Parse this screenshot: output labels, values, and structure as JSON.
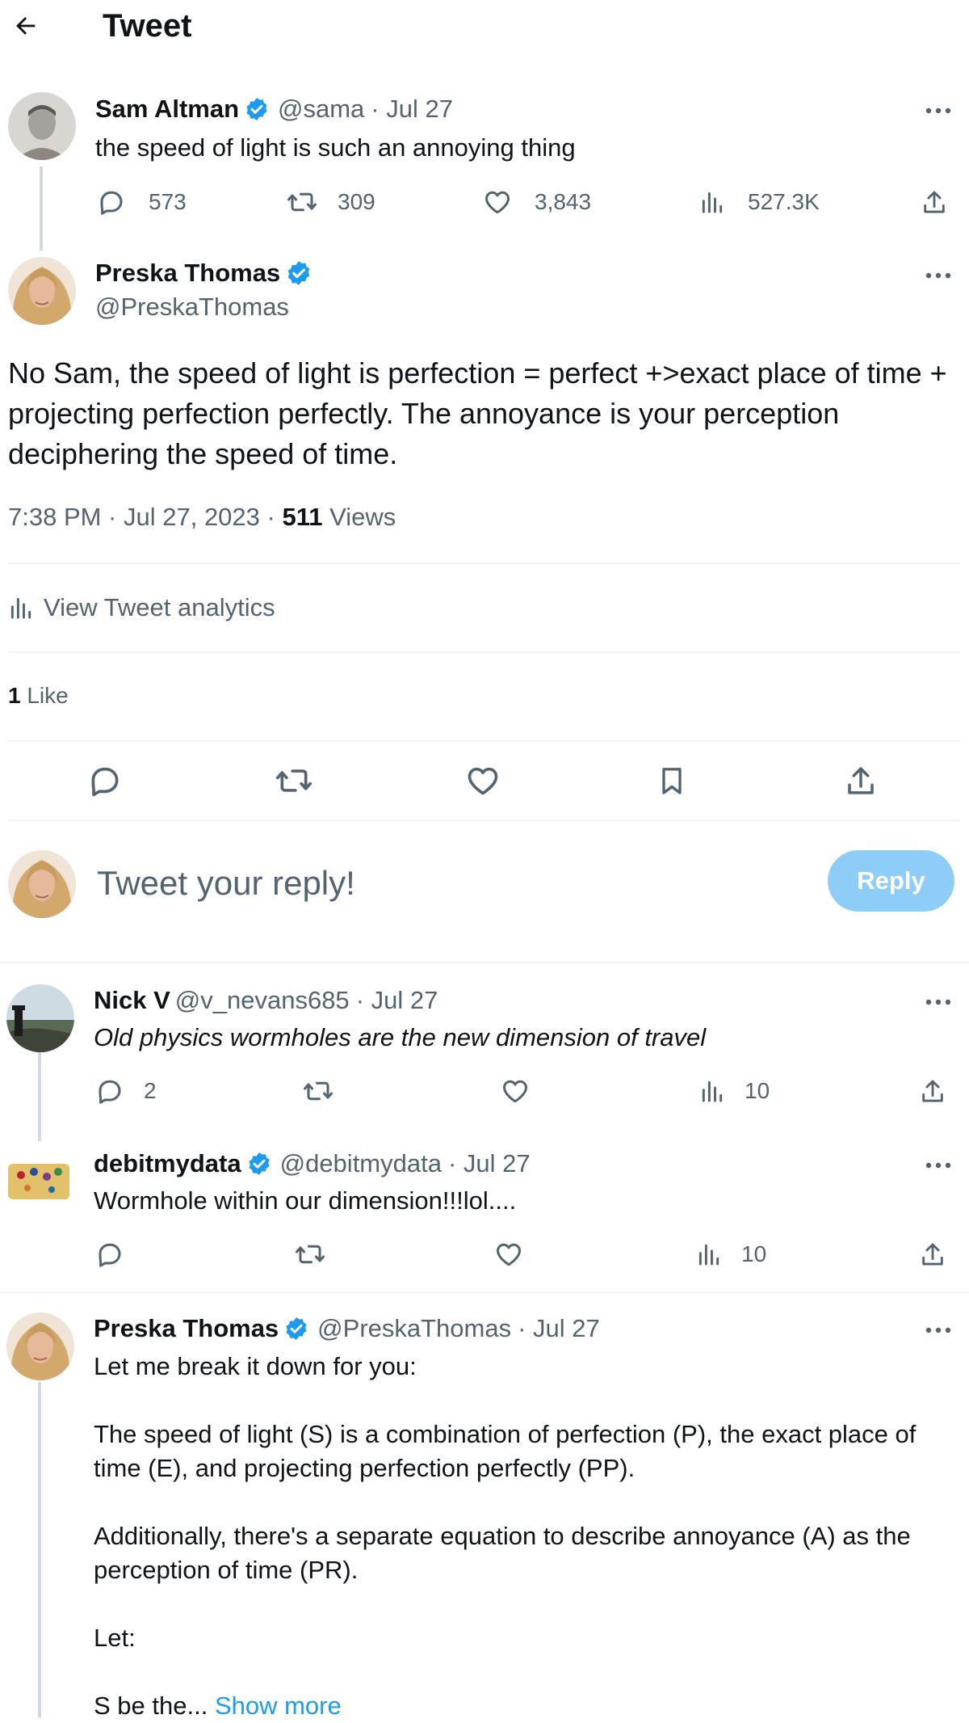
{
  "header": {
    "title": "Tweet"
  },
  "parent_tweet": {
    "author_name": "Sam Altman",
    "handle": "@sama",
    "date": "· Jul 27",
    "text": "the speed of light is such an annoying thing",
    "replies": "573",
    "retweets": "309",
    "likes": "3,843",
    "views": "527.3K"
  },
  "focal_tweet": {
    "author_name": "Preska Thomas",
    "handle": "@PreskaThomas",
    "text": "No Sam, the speed of light is perfection = perfect +>exact place of time + projecting perfection perfectly. The annoyance is your perception deciphering the speed of time.",
    "time_date": "7:38 PM · Jul 27, 2023 · ",
    "views_count": "511",
    "views_label": " Views",
    "analytics_label": "View Tweet analytics",
    "likes_count": "1",
    "likes_label": " Like"
  },
  "composer": {
    "placeholder": "Tweet your reply!",
    "reply_button": "Reply"
  },
  "replies": [
    {
      "author_name": "Nick V",
      "handle": "@v_nevans685",
      "date": "· Jul 27",
      "text": "Old physics wormholes are the new dimension of travel",
      "replies": "2",
      "retweets": "",
      "likes": "",
      "views": "10"
    },
    {
      "author_name": "debitmydata",
      "handle": "@debitmydata",
      "date": "· Jul 27",
      "text": "Wormhole within our dimension!!!lol....",
      "replies": "",
      "retweets": "",
      "likes": "",
      "views": "10"
    },
    {
      "author_name": "Preska Thomas",
      "handle": "@PreskaThomas",
      "date": "· Jul 27",
      "text": "Let me break it down for you:\n\nThe speed of light (S) is a combination of perfection (P), the exact place of time (E), and projecting perfection perfectly (PP).\n\nAdditionally, there's a separate equation to describe annoyance (A) as the perception of time (PR).\n\nLet:\n\nS be the... ",
      "show_more": "Show more"
    }
  ],
  "colors": {
    "accent": "#1d9bf0",
    "text": "#0f1419",
    "muted": "#536471",
    "divider": "#eff3f4",
    "reply_button_disabled": "#8ecdf8"
  },
  "icons": [
    "back-arrow-icon",
    "verified-badge-icon",
    "more-icon",
    "reply-icon",
    "retweet-icon",
    "like-icon",
    "views-icon",
    "share-icon",
    "bookmark-icon",
    "analytics-icon"
  ]
}
